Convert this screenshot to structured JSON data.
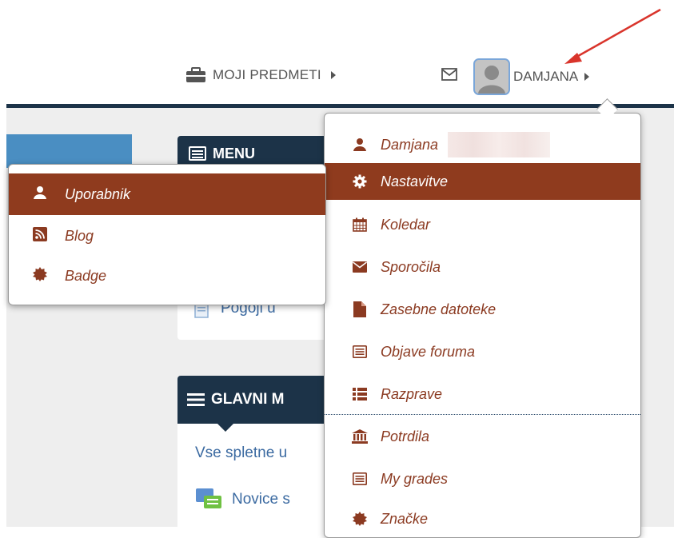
{
  "header": {
    "courses_label": "MOJI PREDMETI",
    "user_label": "DAMJANA"
  },
  "blocks": {
    "menu_title": "MENU",
    "pogoji_link": "Pogoji u",
    "main_title": "GLAVNI M",
    "main_link": "Vse spletne u",
    "novice_link": "Novice s"
  },
  "user_menu": {
    "items": [
      {
        "label": "Damjana",
        "icon": "user-icon"
      },
      {
        "label": "Nastavitve",
        "icon": "gear-icon"
      },
      {
        "label": "Koledar",
        "icon": "calendar-icon"
      },
      {
        "label": "Sporočila",
        "icon": "envelope-icon"
      },
      {
        "label": "Zasebne datoteke",
        "icon": "file-icon"
      },
      {
        "label": "Objave foruma",
        "icon": "list-alt-icon"
      },
      {
        "label": "Razprave",
        "icon": "list-icon"
      },
      {
        "label": "Potrdila",
        "icon": "institution-icon"
      },
      {
        "label": "My grades",
        "icon": "list-alt-icon"
      },
      {
        "label": "Značke",
        "icon": "badge-icon"
      }
    ]
  },
  "sub_menu": {
    "items": [
      {
        "label": "Uporabnik",
        "icon": "user-icon"
      },
      {
        "label": "Blog",
        "icon": "rss-icon"
      },
      {
        "label": "Badge",
        "icon": "badge-icon"
      }
    ]
  },
  "colors": {
    "accent": "#8f3b1e",
    "navy": "#1c3348",
    "link": "#3b6aa1",
    "annotation": "#d9342b"
  }
}
